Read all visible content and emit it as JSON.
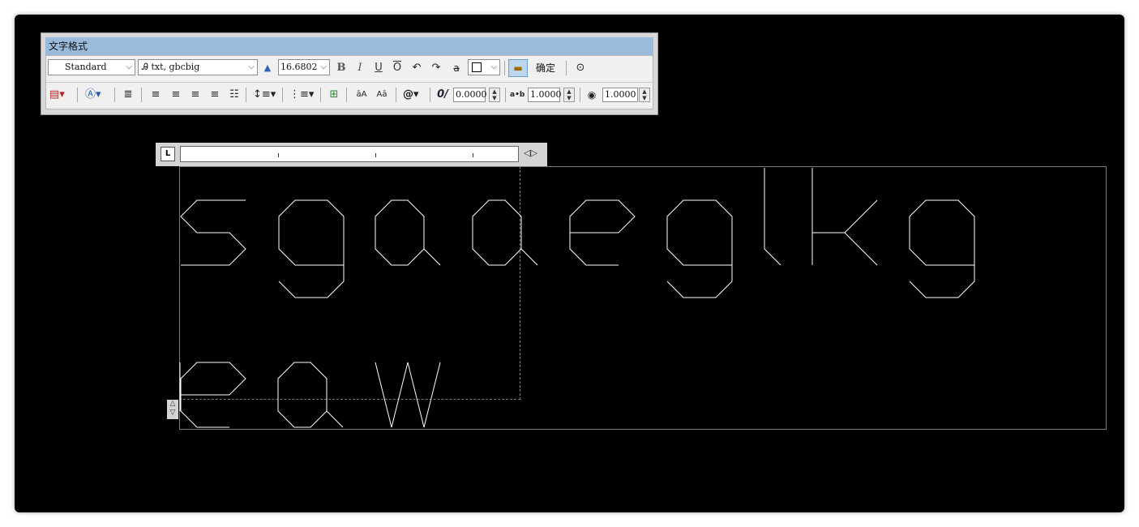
{
  "toolbar": {
    "title": "文字格式",
    "style_combo": "Standard",
    "font_combo": "txt, gbcbig",
    "height_combo": "16.6802",
    "bold": "B",
    "italic": "I",
    "underline": "U",
    "overline": "O",
    "ok_label": "确定",
    "oblique_value": "0.0000",
    "tracking_value": "1.0000",
    "width_value": "1.0000",
    "oblique_icon": "0/",
    "tracking_icon": "a•b",
    "at_icon": "@"
  },
  "ruler": {
    "tab_label": "L"
  },
  "editor": {
    "line1": "sgaaeglkg",
    "line2": "eaw"
  }
}
